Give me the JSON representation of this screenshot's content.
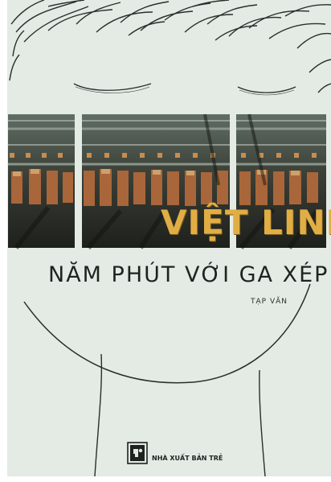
{
  "book": {
    "author": "VIỆT LINH",
    "title": "NĂM PHÚT VỚI GA XÉP",
    "genre": "TẠP VĂN",
    "publisher": "NHÀ XUẤT BẢN TRẺ"
  },
  "colors": {
    "background": "#e3ebe4",
    "author_text": "#e1ae45",
    "line_art": "#2a2e2b"
  }
}
